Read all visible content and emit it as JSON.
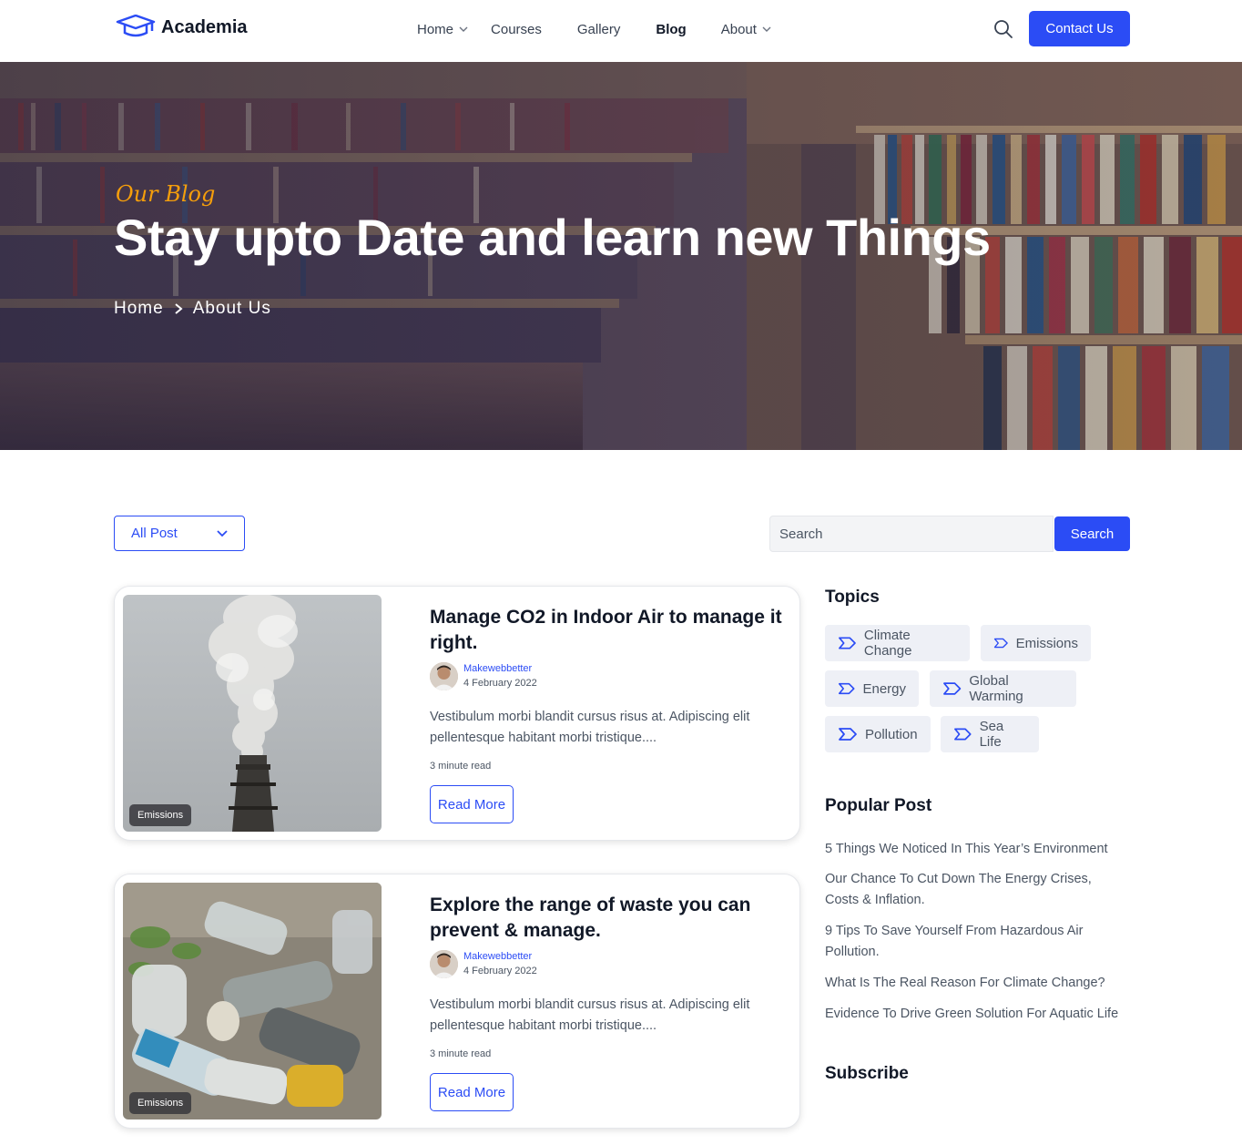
{
  "nav": {
    "logo_text": "Academia",
    "menu": [
      {
        "label": "Home",
        "has_dropdown": true
      },
      {
        "label": "Courses",
        "has_dropdown": false
      },
      {
        "label": "Gallery",
        "has_dropdown": false
      },
      {
        "label": "Blog",
        "has_dropdown": false,
        "active": true
      },
      {
        "label": "About",
        "has_dropdown": true
      }
    ],
    "contact_label": "Contact Us",
    "accent": "#2b4cf5"
  },
  "hero": {
    "tag": "Our Blog",
    "title": "Stay upto Date and learn new Things",
    "breadcrumb": [
      "Home",
      "About Us"
    ]
  },
  "filter": {
    "select_value": "All Post",
    "search_placeholder": "Search",
    "search_button": "Search"
  },
  "posts": [
    {
      "badge": "Emissions",
      "title": "Manage CO2 in Indoor Air to manage it right.",
      "author": "Makewebbetter",
      "date": "4 February 2022",
      "excerpt": "Vestibulum morbi blandit cursus risus at. Adipiscing elit pellentesque habitant morbi tristique....",
      "read_time": "3 minute read",
      "cta": "Read More"
    },
    {
      "badge": "Emissions",
      "title": "Explore the range of waste you can prevent & manage.",
      "author": "Makewebbetter",
      "date": "4 February 2022",
      "excerpt": "Vestibulum morbi blandit cursus risus at. Adipiscing elit pellentesque habitant morbi tristique....",
      "read_time": "3 minute read",
      "cta": "Read More"
    }
  ],
  "sidebar": {
    "topics_heading": "Topics",
    "topics": [
      "Climate Change",
      "Emissions",
      "Energy",
      "Global Warming",
      "Pollution",
      "Sea Life"
    ],
    "popular_heading": "Popular Post",
    "popular": [
      "5 Things We Noticed In This Year’s Environment",
      "Our Chance To Cut Down The Energy Crises, Costs & Inflation.",
      "9 Tips To Save Yourself From Hazardous Air Pollution.",
      "What Is The Real Reason For Climate Change?",
      "Evidence To Drive Green Solution For Aquatic Life"
    ],
    "subscribe_heading": "Subscribe"
  }
}
